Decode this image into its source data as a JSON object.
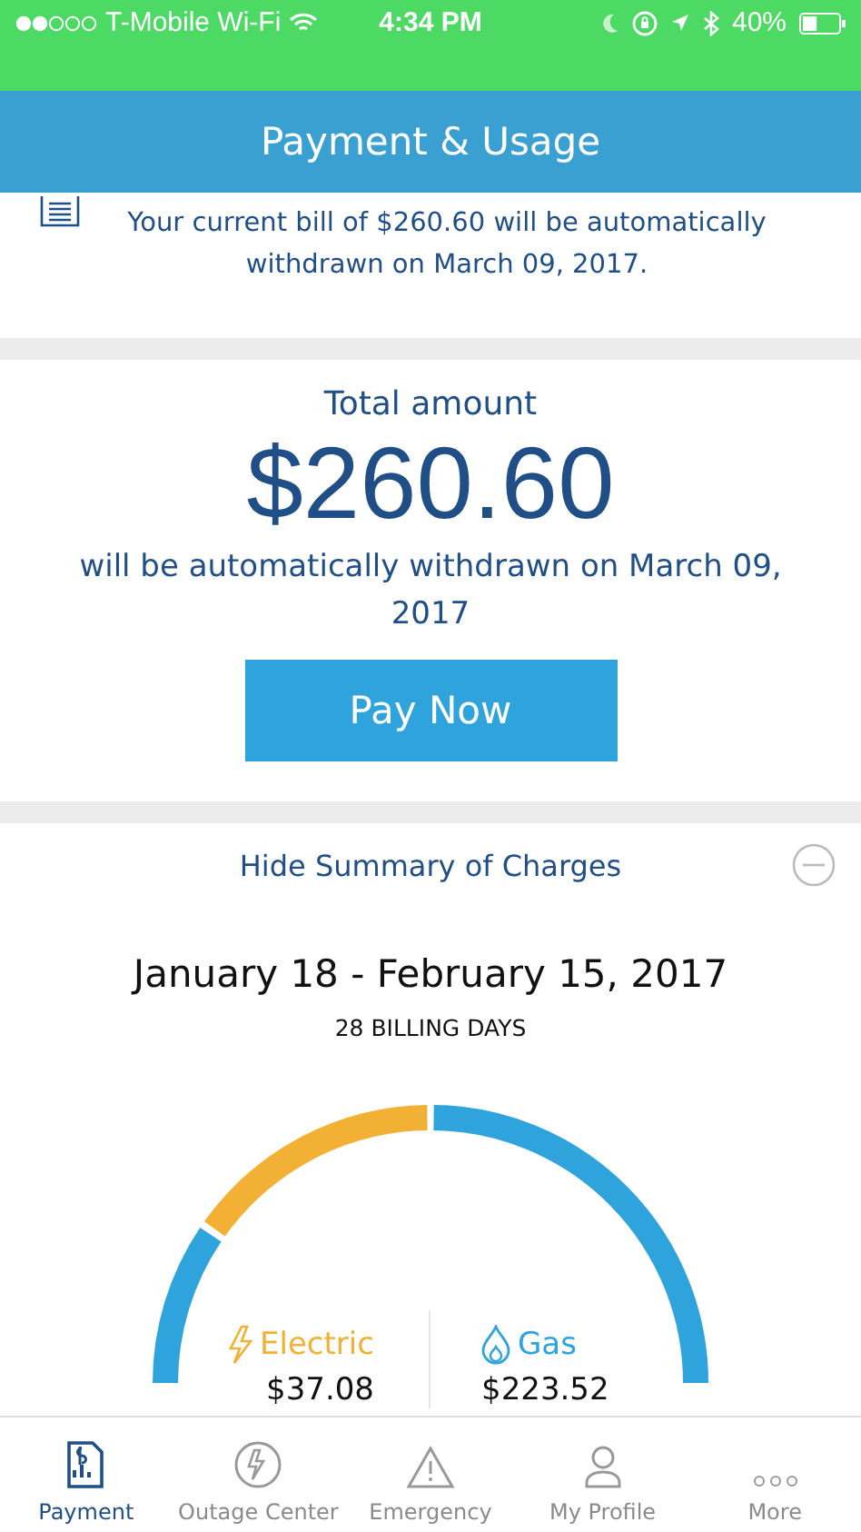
{
  "status_bar": {
    "signal_dots": [
      true,
      true,
      false,
      false,
      false
    ],
    "carrier": "T-Mobile Wi-Fi",
    "time": "4:34 PM",
    "battery": "40%",
    "level": 0.4
  },
  "header": {
    "title": "Payment & Usage"
  },
  "notice": {
    "text": "Your current bill of $260.60 will be automatically withdrawn on March 09, 2017."
  },
  "total": {
    "label": "Total amount",
    "amount": "$260.60",
    "note": "will be automatically withdrawn on March 09, 2017",
    "button": "Pay Now"
  },
  "summary": {
    "toggle": "Hide Summary of Charges",
    "expanded": true,
    "period": "January 18 - February 15, 2017",
    "billing_days": "28 BILLING DAYS",
    "charges": [
      {
        "kind": "electric",
        "label": "Electric",
        "amount": "$37.08",
        "color": "#f2b134"
      },
      {
        "kind": "gas",
        "label": "Gas",
        "amount": "$223.52",
        "color": "#2ea3dc"
      }
    ]
  },
  "tab_bar": [
    {
      "kind": "payment",
      "label": "Payment",
      "selected": true
    },
    {
      "kind": "outage",
      "label": "Outage Center",
      "selected": false
    },
    {
      "kind": "emergency",
      "label": "Emergency",
      "selected": false
    },
    {
      "kind": "profile",
      "label": "My Profile",
      "selected": false
    },
    {
      "kind": "more",
      "label": "More",
      "selected": false
    }
  ]
}
